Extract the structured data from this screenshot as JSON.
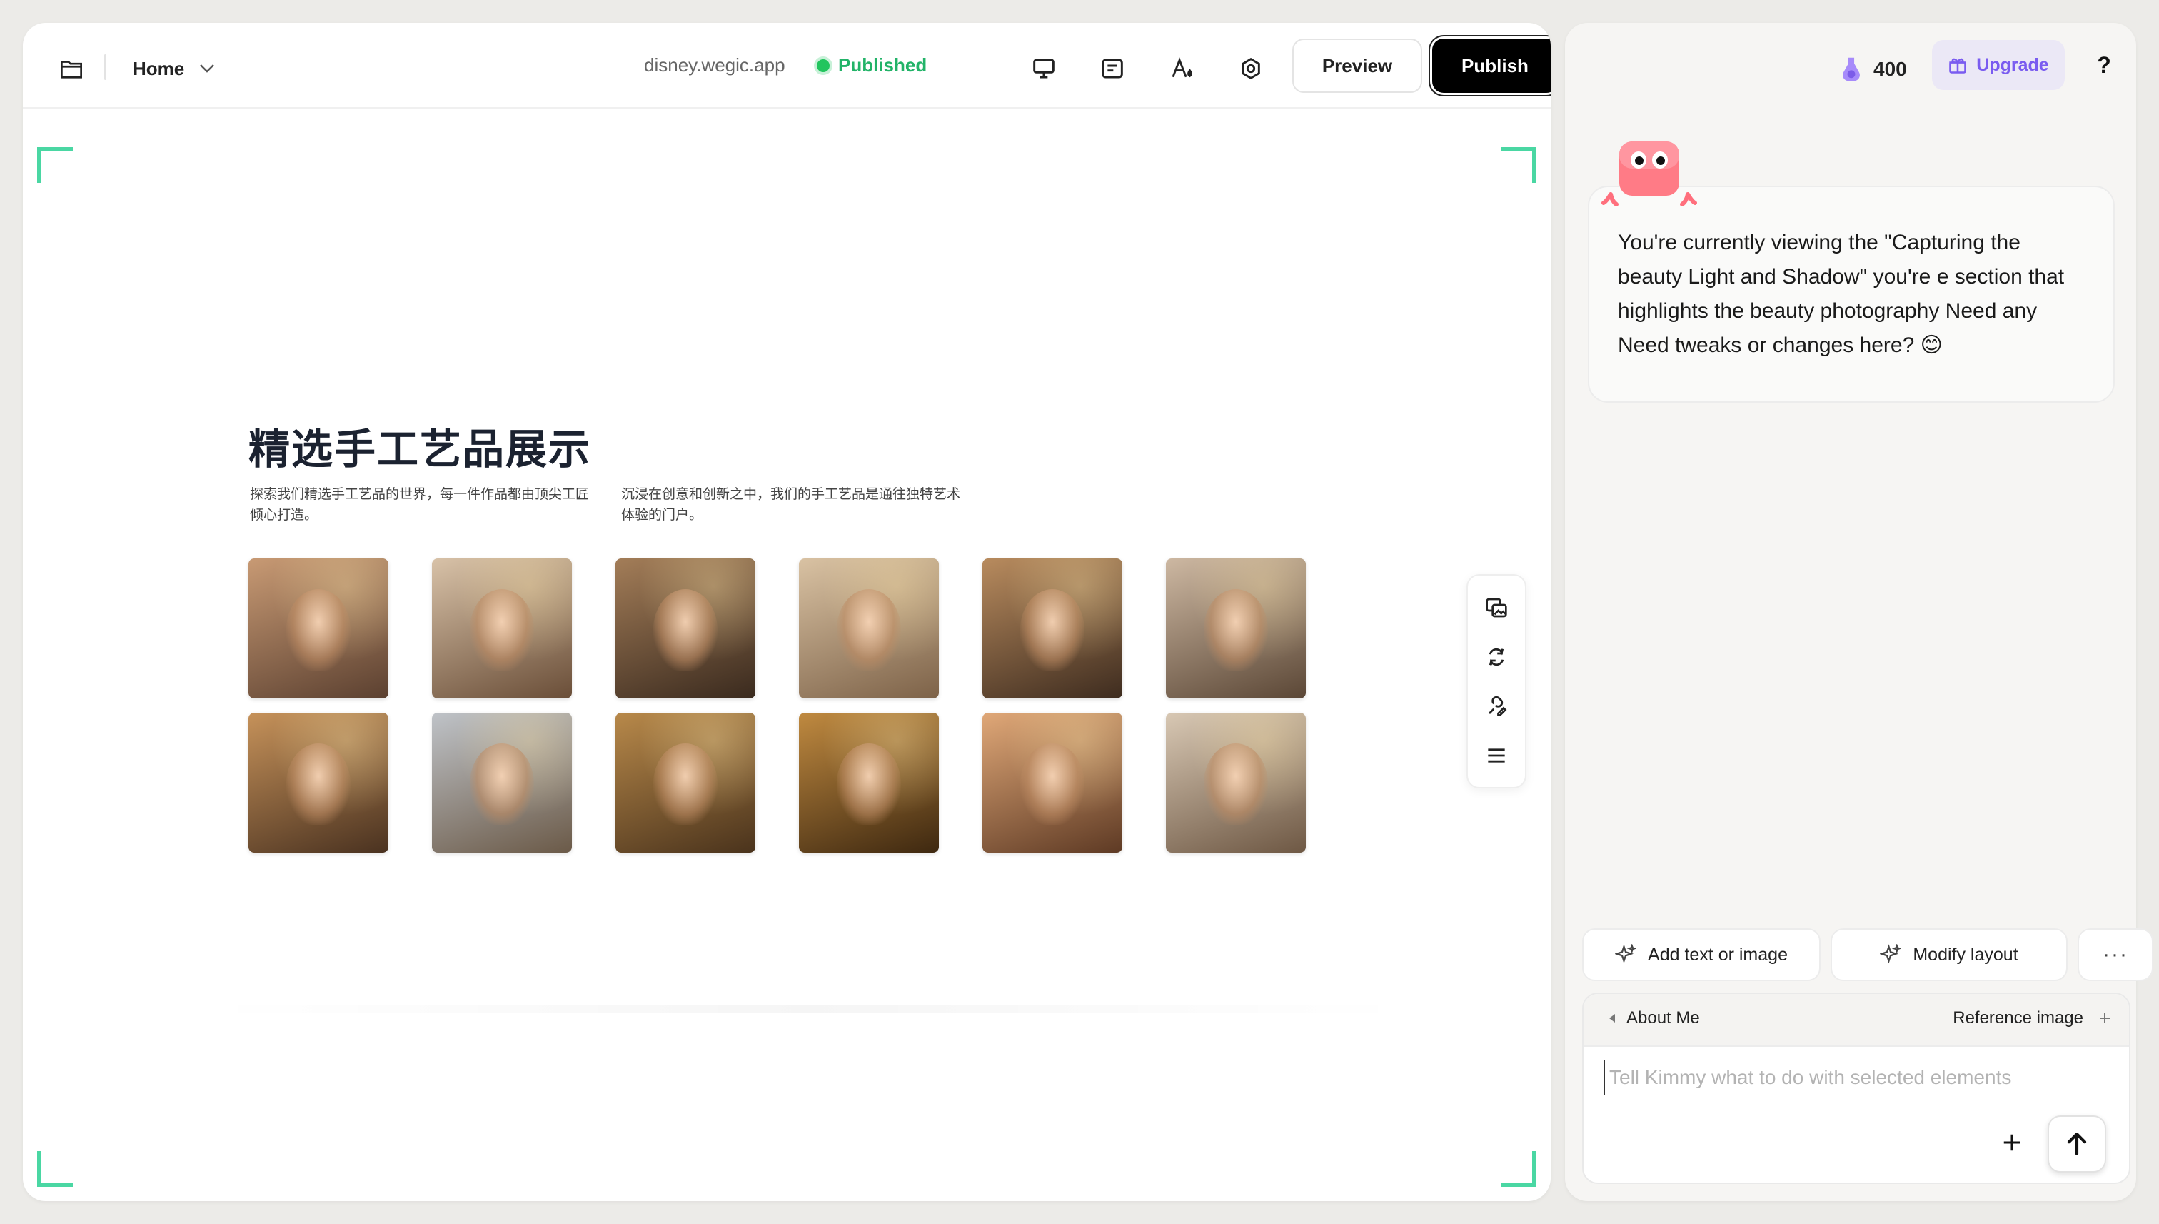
{
  "topbar": {
    "page_selector": "Home",
    "domain": "disney.wegic.app",
    "status": "Published",
    "preview_label": "Preview",
    "publish_label": "Publish",
    "icons": [
      "folder-icon",
      "chevron-down-icon",
      "desktop-icon",
      "text-box-icon",
      "font-icon",
      "settings-icon"
    ]
  },
  "canvas": {
    "section_title": "精选手工艺品展示",
    "desc_left": "探索我们精选手工艺品的世界，每一件作品都由顶尖工匠倾心打造。",
    "desc_right": "沉浸在创意和创新之中，我们的手工艺品是通往独特艺术体验的门户。",
    "photos": [
      {
        "colors": [
          "#c89a74",
          "#5b4030"
        ]
      },
      {
        "colors": [
          "#d8c2a8",
          "#6a4e38"
        ]
      },
      {
        "colors": [
          "#a37d58",
          "#3a2a1e"
        ]
      },
      {
        "colors": [
          "#d9c2a3",
          "#7d6248"
        ]
      },
      {
        "colors": [
          "#b88b5e",
          "#3e2c1f"
        ]
      },
      {
        "colors": [
          "#cdb8a2",
          "#5b4736"
        ]
      },
      {
        "colors": [
          "#c6925a",
          "#4a3220"
        ]
      },
      {
        "colors": [
          "#bfc3c8",
          "#6b5a48"
        ]
      },
      {
        "colors": [
          "#b8894a",
          "#4a331c"
        ]
      },
      {
        "colors": [
          "#c08a40",
          "#3e2810"
        ]
      },
      {
        "colors": [
          "#e0a878",
          "#5e3a24"
        ]
      },
      {
        "colors": [
          "#d8c8b4",
          "#6e5844"
        ]
      }
    ],
    "side_tools": [
      "replace-image-icon",
      "regenerate-icon",
      "edit-link-icon",
      "menu-icon"
    ],
    "accent_color": "#4ad7a3"
  },
  "assistant": {
    "credits": "400",
    "upgrade_label": "Upgrade",
    "help_label": "?",
    "message": "You're currently viewing the \"Capturing the beauty  Light and Shadow\" you're e section that highlights the beauty photography  Need any Need  tweaks or changes here? 😊",
    "chip_add": "Add text or image",
    "chip_modify": "Modify layout",
    "chip_more": "···",
    "context_tag": "About Me",
    "reference_label": "Reference image",
    "input_placeholder": "Tell Kimmy what to do with selected elements",
    "brand_color": "#7a5cf0"
  }
}
